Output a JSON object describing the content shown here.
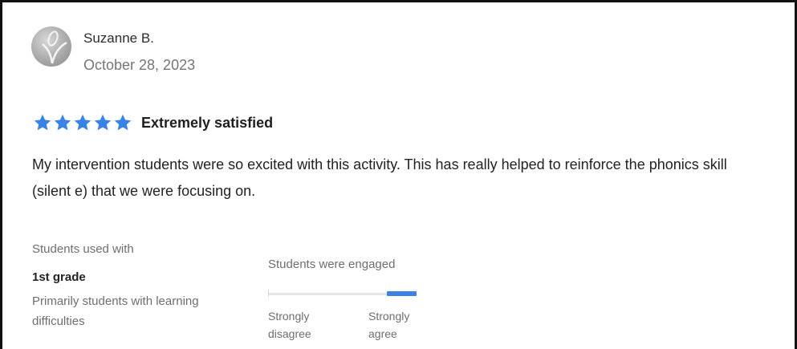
{
  "reviewer": {
    "name": "Suzanne B.",
    "date": "October 28, 2023"
  },
  "rating": {
    "stars": 5,
    "max_stars": 5,
    "label": "Extremely satisfied",
    "star_color": "#3b82e6"
  },
  "review": {
    "text": "My intervention students were so excited with this activity.  This has really helped to reinforce the phonics skill (silent e) that we were focusing on."
  },
  "students_used_with": {
    "label": "Students used with",
    "grade": "1st grade",
    "type": "Primarily students with learning difficulties"
  },
  "engagement": {
    "label": "Students were engaged",
    "level": 5,
    "max_level": 5,
    "min_label": "Strongly disagree",
    "max_label": "Strongly agree",
    "fill_color": "#3b82e6"
  }
}
